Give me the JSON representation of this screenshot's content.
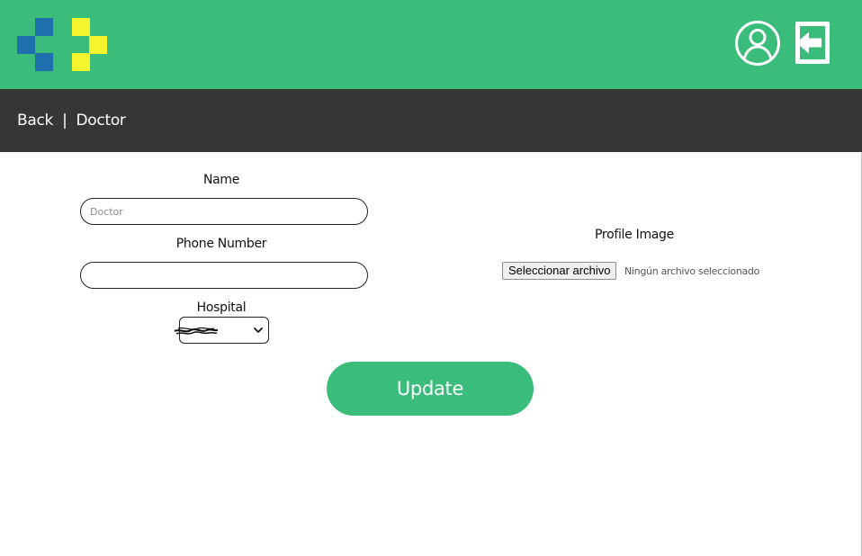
{
  "header": {
    "logo_icon": "pixel-cross-logo",
    "profile_icon": "user-circle-icon",
    "logout_icon": "logout-arrow-icon",
    "colors": {
      "primary": "#3abd7a",
      "logo_blue": "#1f6fae",
      "logo_yellow": "#f6f52d"
    }
  },
  "nav": {
    "back_label": "Back",
    "separator": "|",
    "page_label": "Doctor",
    "color": "#363636"
  },
  "form": {
    "name": {
      "label": "Name",
      "value": "",
      "placeholder": "Doctor"
    },
    "phone": {
      "label": "Phone Number",
      "value": "",
      "placeholder": ""
    },
    "hospital": {
      "label": "Hospital",
      "selected": ""
    },
    "profile_image": {
      "label": "Profile Image",
      "button_label": "Seleccionar archivo",
      "status": "Ningún archivo seleccionado"
    },
    "update_label": "Update"
  }
}
